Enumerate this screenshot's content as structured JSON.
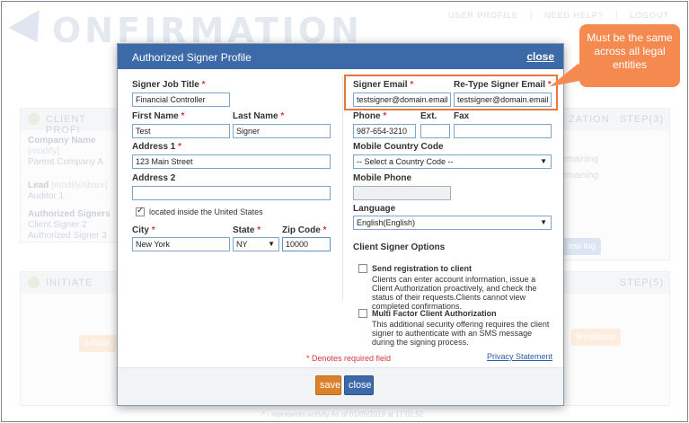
{
  "background": {
    "logo_text": "ONFIRMATION",
    "nav": [
      "USER PROFILE",
      "NEED HELP?",
      "LOGOUT"
    ],
    "client_panel_title": "CLIENT PROFI",
    "company_label": "Company Name",
    "company_link": "[modify]",
    "company_value": "Parent Company A",
    "lead_label": "Lead",
    "lead_link": "[modify/share]",
    "lead_value": "Auditor 1",
    "signers_label": "Authorized Signers",
    "signer_1": "Client Signer 2",
    "signer_2": "Authorized Signer 3",
    "right_panel_title": "ZATION",
    "right_step": "STEP(3)",
    "remaining_1": "remaining",
    "remaining_2": "remaining",
    "view_log": "iew log",
    "initiate_title": "INITIATE",
    "initiate_step": "STEP(5)",
    "initiate_btn": "initiate",
    "confirmations_btn": "firmations",
    "footer_note": "* - represents activity As of 01/09/2019 at 17:02:52"
  },
  "modal": {
    "title": "Authorized Signer Profile",
    "close_link": "close",
    "job_title_label": "Signer Job Title",
    "job_title_value": "Financial Controller",
    "first_name_label": "First Name",
    "first_name_value": "Test",
    "last_name_label": "Last Name",
    "last_name_value": "Signer",
    "address1_label": "Address 1",
    "address1_value": "123 Main Street",
    "address2_label": "Address 2",
    "address2_value": "",
    "us_checkbox_label": "located inside the United States",
    "city_label": "City",
    "city_value": "New York",
    "state_label": "State",
    "state_value": "NY",
    "zip_label": "Zip Code",
    "zip_value": "10000",
    "email_label": "Signer Email",
    "email_value": "testsigner@domain.email",
    "retype_label": "Re-Type Signer Email",
    "retype_value": "testsigner@domain.email",
    "phone_label": "Phone",
    "phone_value": "987-654-3210",
    "ext_label": "Ext.",
    "ext_value": "",
    "fax_label": "Fax",
    "fax_value": "",
    "mcc_label": "Mobile Country Code",
    "mcc_value": "-- Select a Country Code --",
    "mobile_label": "Mobile Phone",
    "mobile_value": "",
    "language_label": "Language",
    "language_value": "English(English)",
    "options_title": "Client Signer Options",
    "opt1_title": "Send registration to client",
    "opt1_desc": "Clients can enter account information, issue a Client Authorization proactively, and check the status of their requests.Clients cannot view completed confirmations.",
    "opt2_title": "Multi Factor Client Authorization",
    "opt2_desc": "This additional security offering requires the client signer to authenticate with an SMS message during the signing process.",
    "required_note": "* Denotes required field",
    "privacy_link": "Privacy Statement",
    "save_label": "save",
    "close_label": "close",
    "req_mark": "*"
  },
  "callout": {
    "text": "Must be the same across all legal entities"
  }
}
